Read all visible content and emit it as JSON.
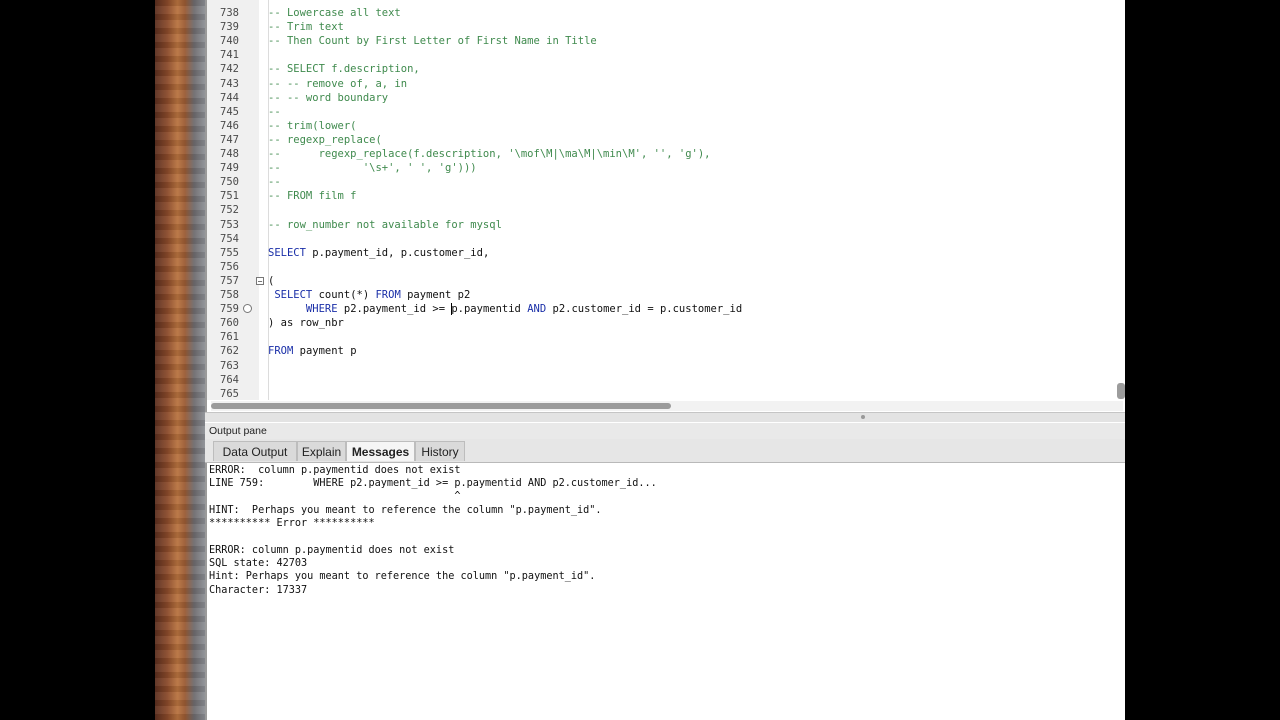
{
  "editor": {
    "lines": [
      {
        "num": "738",
        "segments": [
          {
            "t": "-- Lowercase all text",
            "c": "comment"
          }
        ]
      },
      {
        "num": "739",
        "segments": [
          {
            "t": "-- Trim text",
            "c": "comment"
          }
        ]
      },
      {
        "num": "740",
        "segments": [
          {
            "t": "-- Then Count by First Letter of First Name in Title",
            "c": "comment"
          }
        ]
      },
      {
        "num": "741",
        "segments": []
      },
      {
        "num": "742",
        "segments": [
          {
            "t": "-- SELECT f.description,",
            "c": "comment"
          }
        ]
      },
      {
        "num": "743",
        "segments": [
          {
            "t": "-- -- remove of, a, in",
            "c": "comment"
          }
        ]
      },
      {
        "num": "744",
        "segments": [
          {
            "t": "-- -- word boundary",
            "c": "comment"
          }
        ]
      },
      {
        "num": "745",
        "segments": [
          {
            "t": "--",
            "c": "comment"
          }
        ]
      },
      {
        "num": "746",
        "segments": [
          {
            "t": "-- trim(lower(",
            "c": "comment"
          }
        ]
      },
      {
        "num": "747",
        "segments": [
          {
            "t": "-- regexp_replace(",
            "c": "comment"
          }
        ]
      },
      {
        "num": "748",
        "segments": [
          {
            "t": "--      regexp_replace(f.description, '\\mof\\M|\\ma\\M|\\min\\M', '', 'g'),",
            "c": "comment"
          }
        ]
      },
      {
        "num": "749",
        "segments": [
          {
            "t": "--             '\\s+', ' ', 'g')))",
            "c": "comment"
          }
        ]
      },
      {
        "num": "750",
        "segments": [
          {
            "t": "--",
            "c": "comment"
          }
        ]
      },
      {
        "num": "751",
        "segments": [
          {
            "t": "-- FROM film f",
            "c": "comment"
          }
        ]
      },
      {
        "num": "752",
        "segments": []
      },
      {
        "num": "753",
        "segments": [
          {
            "t": "-- row_number not available for mysql",
            "c": "comment"
          }
        ]
      },
      {
        "num": "754",
        "segments": []
      },
      {
        "num": "755",
        "segments": [
          {
            "t": "SELECT",
            "c": "kw"
          },
          {
            "t": " p.payment_id, p.customer_id,",
            "c": "plain"
          }
        ]
      },
      {
        "num": "756",
        "segments": []
      },
      {
        "num": "757",
        "segments": [
          {
            "t": "(",
            "c": "plain"
          }
        ]
      },
      {
        "num": "758",
        "segments": [
          {
            "t": " SELECT",
            "c": "kw"
          },
          {
            "t": " count(*) ",
            "c": "plain"
          },
          {
            "t": "FROM",
            "c": "kw"
          },
          {
            "t": " payment p2",
            "c": "plain"
          }
        ]
      },
      {
        "num": "759",
        "segments": [
          {
            "t": "      WHERE",
            "c": "kw"
          },
          {
            "t": " p2.payment_id >= ",
            "c": "plain"
          },
          {
            "t": "|",
            "c": "caret"
          },
          {
            "t": "p.paymentid ",
            "c": "plain"
          },
          {
            "t": "AND",
            "c": "kw"
          },
          {
            "t": " p2.customer_id = p.customer_id",
            "c": "plain"
          }
        ]
      },
      {
        "num": "760",
        "segments": [
          {
            "t": ") as row_nbr",
            "c": "plain"
          }
        ]
      },
      {
        "num": "761",
        "segments": []
      },
      {
        "num": "762",
        "segments": [
          {
            "t": "FROM",
            "c": "kw"
          },
          {
            "t": " payment p",
            "c": "plain"
          }
        ]
      },
      {
        "num": "763",
        "segments": []
      },
      {
        "num": "764",
        "segments": []
      },
      {
        "num": "765",
        "segments": []
      }
    ]
  },
  "output_pane": {
    "title": "Output pane",
    "tabs": [
      "Data Output",
      "Explain",
      "Messages",
      "History"
    ],
    "active_tab": "Messages",
    "messages": [
      "ERROR:  column p.paymentid does not exist",
      "LINE 759:        WHERE p2.payment_id >= p.paymentid AND p2.customer_id...",
      "                                        ^",
      "HINT:  Perhaps you meant to reference the column \"p.payment_id\".",
      "********** Error **********",
      "",
      "ERROR: column p.paymentid does not exist",
      "SQL state: 42703",
      "Hint: Perhaps you meant to reference the column \"p.payment_id\".",
      "Character: 17337"
    ]
  }
}
